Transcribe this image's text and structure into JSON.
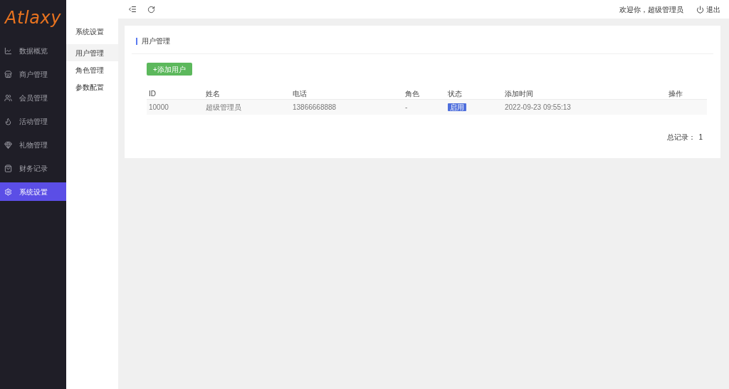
{
  "logo": "Atlaxy",
  "sidebar": {
    "items": [
      {
        "label": "数据概览",
        "selected": false
      },
      {
        "label": "商户管理",
        "selected": false
      },
      {
        "label": "会员管理",
        "selected": false
      },
      {
        "label": "活动管理",
        "selected": false
      },
      {
        "label": "礼物管理",
        "selected": false
      },
      {
        "label": "财务记录",
        "selected": false
      },
      {
        "label": "系统设置",
        "selected": true
      }
    ]
  },
  "submenu": {
    "title": "系统设置",
    "items": [
      {
        "label": "用户管理",
        "selected": true
      },
      {
        "label": "角色管理",
        "selected": false
      },
      {
        "label": "参数配置",
        "selected": false
      }
    ]
  },
  "header": {
    "welcome": "欢迎你，超级管理员",
    "logout": "退出"
  },
  "card": {
    "title": "用户管理",
    "add_button": "+添加用户",
    "table": {
      "columns": [
        "ID",
        "姓名",
        "电话",
        "角色",
        "状态",
        "添加时间",
        "操作"
      ],
      "rows": [
        {
          "id": "10000",
          "name": "超级管理员",
          "phone": "13866668888",
          "role": "-",
          "status": "启用",
          "enabled": true,
          "added": "2022-09-23 09:55:13"
        }
      ]
    },
    "total_label": "总记录：",
    "total": "1"
  }
}
